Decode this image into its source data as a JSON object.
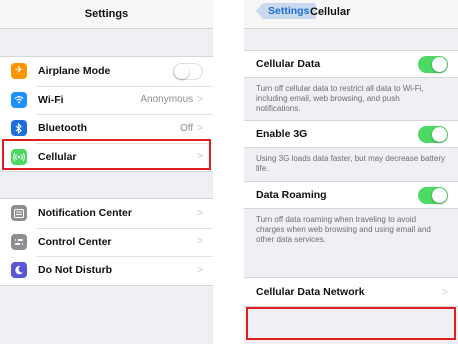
{
  "left": {
    "title": "Settings",
    "group1": [
      {
        "label": "Airplane Mode",
        "icon": "airplane-icon",
        "color": "#ff9500",
        "toggle": "off"
      },
      {
        "label": "Wi-Fi",
        "icon": "wifi-icon",
        "color": "#1e90ff",
        "value": "Anonymous"
      },
      {
        "label": "Bluetooth",
        "icon": "bluetooth-icon",
        "color": "#1e6fd9",
        "value": "Off"
      },
      {
        "label": "Cellular",
        "icon": "cellular-icon",
        "color": "#4cd964",
        "value": ""
      }
    ],
    "group2": [
      {
        "label": "Notification Center",
        "icon": "notification-center-icon",
        "color": "#8e8e93"
      },
      {
        "label": "Control Center",
        "icon": "control-center-icon",
        "color": "#8e8e93"
      },
      {
        "label": "Do Not Disturb",
        "icon": "moon-icon",
        "color": "#5856d6"
      }
    ]
  },
  "right": {
    "back_label": "Settings",
    "title": "Cellular",
    "cellular_data": {
      "label": "Cellular Data",
      "toggle": "on",
      "desc": "Turn off cellular data to restrict all data to Wi-Fi, including email, web browsing, and push notifications."
    },
    "enable_3g": {
      "label": "Enable 3G",
      "toggle": "on",
      "desc": "Using 3G loads data faster, but may decrease battery life."
    },
    "data_roaming": {
      "label": "Data Roaming",
      "toggle": "on",
      "desc": "Turn off data roaming when traveling to avoid charges when web browsing and using email and other data services."
    },
    "cellular_data_network": {
      "label": "Cellular Data Network"
    }
  },
  "colors": {
    "highlight": "#e02020",
    "toggle_on": "#4cd964",
    "link": "#1b6fd3"
  }
}
